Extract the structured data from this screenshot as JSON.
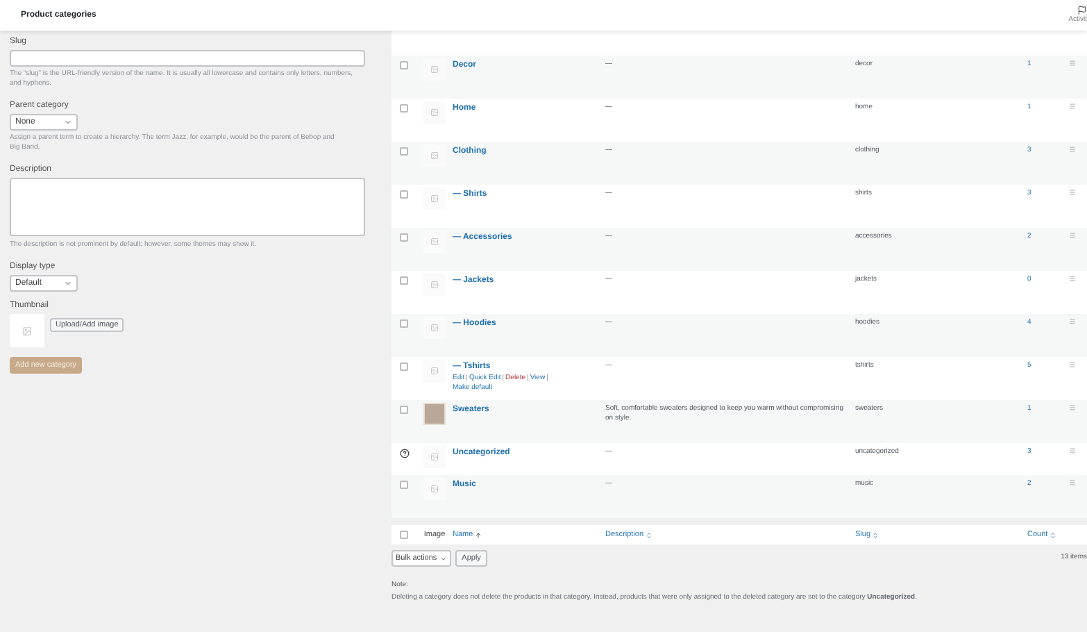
{
  "header": {
    "title": "Product categories",
    "activity_label": "Activit"
  },
  "form": {
    "slug": {
      "label": "Slug",
      "help": "The “slug” is the URL-friendly version of the name. It is usually all lowercase and contains only letters, numbers, and hyphens."
    },
    "parent": {
      "label": "Parent category",
      "value": "None",
      "help": "Assign a parent term to create a hierarchy. The term Jazz, for example, would be the parent of Bebop and Big Band."
    },
    "description": {
      "label": "Description",
      "help": "The description is not prominent by default; however, some themes may show it."
    },
    "display_type": {
      "label": "Display type",
      "value": "Default"
    },
    "thumbnail": {
      "label": "Thumbnail",
      "button": "Upload/Add image"
    },
    "submit": "Add new category"
  },
  "table": {
    "rows": [
      {
        "kind": "checkbox",
        "checked": false,
        "has_photo": false,
        "name": "Decor",
        "description": "—",
        "slug": "decor",
        "count": "1"
      },
      {
        "kind": "checkbox",
        "checked": false,
        "has_photo": false,
        "name": "Home",
        "description": "—",
        "slug": "home",
        "count": "1"
      },
      {
        "kind": "checkbox",
        "checked": false,
        "has_photo": false,
        "name": "Clothing",
        "description": "—",
        "slug": "clothing",
        "count": "3"
      },
      {
        "kind": "checkbox",
        "checked": false,
        "has_photo": false,
        "name": "— Shirts",
        "description": "—",
        "slug": "shirts",
        "count": "3"
      },
      {
        "kind": "checkbox",
        "checked": false,
        "has_photo": false,
        "name": "— Accessories",
        "description": "—",
        "slug": "accessories",
        "count": "2"
      },
      {
        "kind": "checkbox",
        "checked": false,
        "has_photo": false,
        "name": "— Jackets",
        "description": "—",
        "slug": "jackets",
        "count": "0"
      },
      {
        "kind": "checkbox",
        "checked": false,
        "has_photo": false,
        "name": "— Hoodies",
        "description": "—",
        "slug": "hoodies",
        "count": "4"
      },
      {
        "kind": "checkbox",
        "checked": false,
        "has_photo": false,
        "name": "— Tshirts",
        "description": "—",
        "slug": "tshirts",
        "count": "5",
        "actions": [
          {
            "kind": "link",
            "label": "Edit"
          },
          {
            "kind": "separator",
            "label": "|"
          },
          {
            "kind": "link",
            "label": "Quick Edit"
          },
          {
            "kind": "separator",
            "label": "|"
          },
          {
            "kind": "delete",
            "label": "Delete"
          },
          {
            "kind": "separator",
            "label": "|"
          },
          {
            "kind": "link",
            "label": "View"
          },
          {
            "kind": "separator",
            "label": "|"
          },
          {
            "kind": "link",
            "label": "Make default"
          }
        ]
      },
      {
        "kind": "checkbox",
        "checked": false,
        "has_photo": true,
        "name": "Sweaters",
        "description": "Soft, comfortable sweaters designed to keep you warm without compromising on style.",
        "slug": "sweaters",
        "count": "1"
      },
      {
        "kind": "help",
        "has_photo": false,
        "name": "Uncategorized",
        "description": "—",
        "slug": "uncategorized",
        "count": "3"
      },
      {
        "kind": "checkbox",
        "checked": false,
        "has_photo": false,
        "name": "Music",
        "description": "—",
        "slug": "music",
        "count": "2"
      }
    ],
    "select_all_checked": false,
    "columns": [
      {
        "label": "Image",
        "sortable": false,
        "sorted": false
      },
      {
        "label": "Name",
        "sortable": true,
        "sorted": true
      },
      {
        "label": "Description",
        "sortable": true,
        "sorted": false
      },
      {
        "label": "Slug",
        "sortable": true,
        "sorted": false
      },
      {
        "label": "Count",
        "sortable": true,
        "sorted": false
      }
    ],
    "bulk_actions": "Bulk actions",
    "apply": "Apply",
    "item_count": "13 items"
  },
  "note": {
    "title": "Note:",
    "text": "Deleting a category does not delete the products in that category. Instead, products that were only assigned to the deleted category are set to the category **Uncategorized**."
  }
}
